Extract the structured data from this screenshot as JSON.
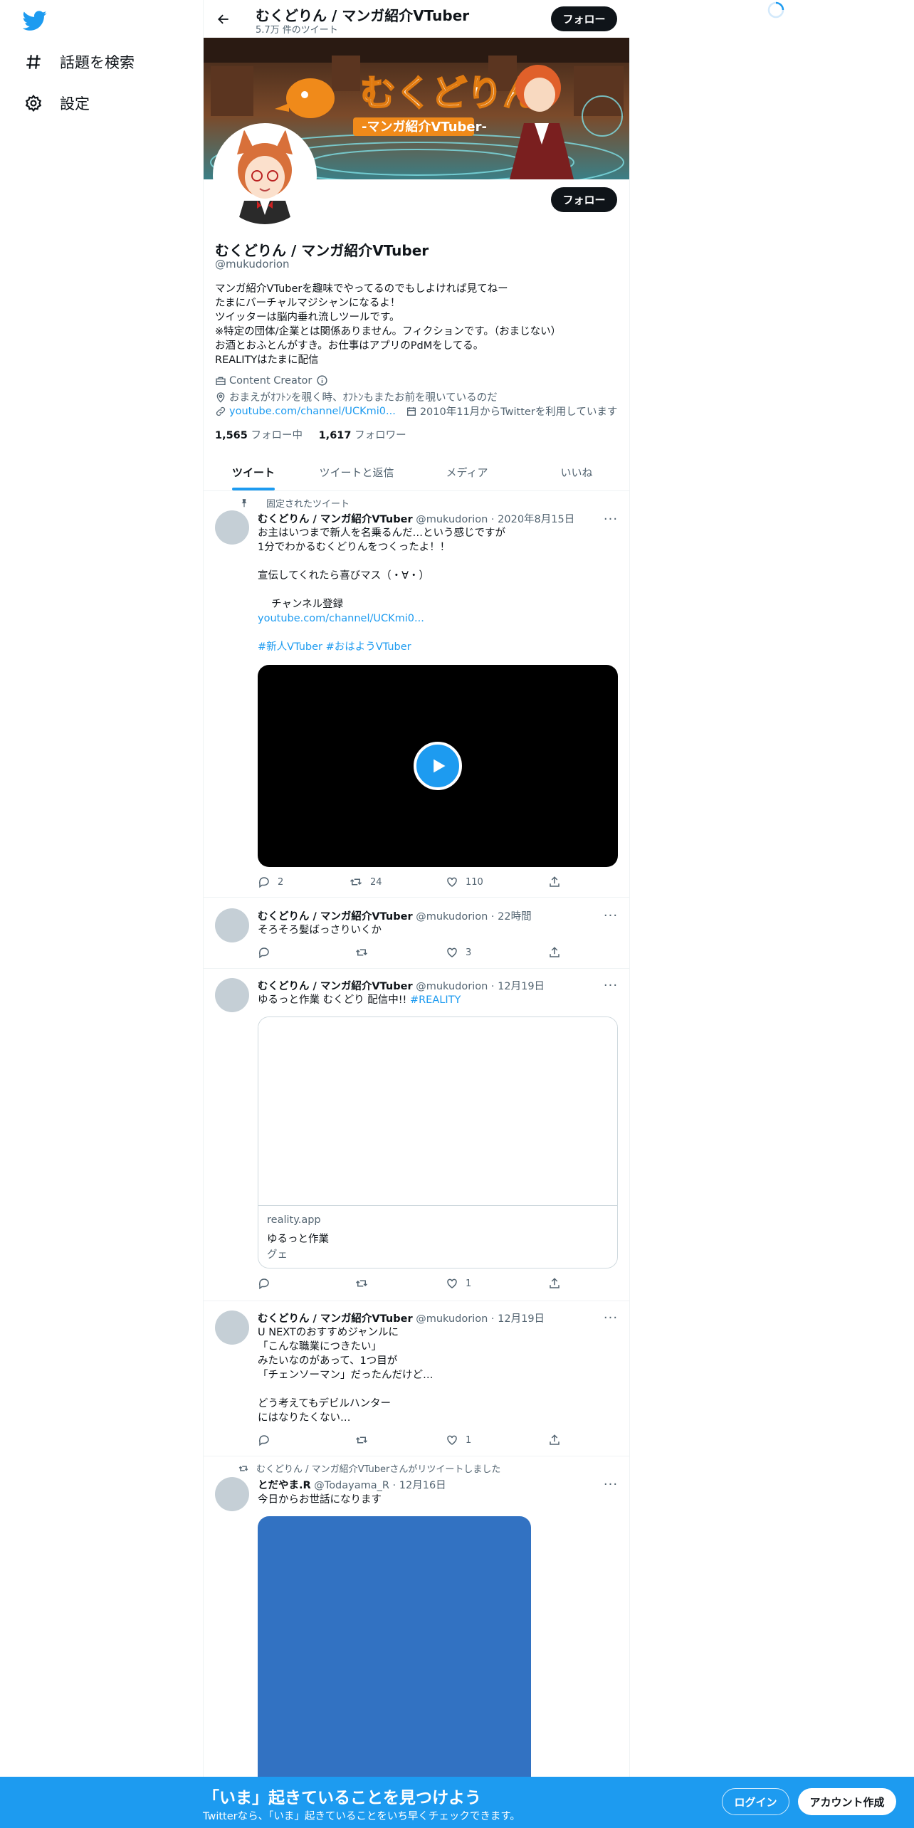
{
  "nav": {
    "explore": "話題を検索",
    "settings": "設定"
  },
  "header": {
    "name": "むくどりん / マンガ紹介VTuber",
    "tweet_count": "5.7万 件のツイート",
    "follow": "フォロー"
  },
  "banner": {
    "title": "むくどりん",
    "subtitle": "-マンガ紹介VTuber-"
  },
  "profile": {
    "name": "むくどりん / マンガ紹介VTuber",
    "handle": "@mukudorion",
    "follow": "フォロー",
    "bio": "マンガ紹介VTuberを趣味でやってるのでもしよければ見てねー\nたまにバーチャルマジシャンになるよ！\nツイッターは脳内垂れ流しツールです。\n※特定の団体/企業とは関係ありません。フィクションです。（おまじない）\nお酒とおふとんがすき。お仕事はアプリのPdMをしてる。\nREALITYはたまに配信",
    "category": "Content Creator",
    "location": "おまえがｵﾌﾄﾝを覗く時、ｵﾌﾄﾝもまたお前を覗いているのだ",
    "url": "youtube.com/channel/UCKmi0...",
    "joined": "2010年11月からTwitterを利用しています",
    "following_count": "1,565",
    "following_label": "フォロー中",
    "followers_count": "1,617",
    "followers_label": "フォロワー"
  },
  "tabs": [
    "ツイート",
    "ツイートと返信",
    "メディア",
    "いいね"
  ],
  "tweets": [
    {
      "context": "固定されたツイート",
      "name": "むくどりん / マンガ紹介VTuber",
      "handle": "@mukudorion",
      "time": "2020年8月15日",
      "text": "お主はいつまで新人を名乗るんだ…という感じですが\n1分でわかるむくどりんをつくったよ！！\n\n宣伝してくれたら喜びマス（・∀・）\n\n　 チャンネル登録",
      "link": "youtube.com/channel/UCKmi0...",
      "hashtags": "#新人VTuber #おはようVTuber",
      "replies": "2",
      "retweets": "24",
      "likes": "110"
    },
    {
      "name": "むくどりん / マンガ紹介VTuber",
      "handle": "@mukudorion",
      "time": "22時間",
      "text": "そろそろ髪ばっさりいくか",
      "replies": "",
      "retweets": "",
      "likes": "3"
    },
    {
      "name": "むくどりん / マンガ紹介VTuber",
      "handle": "@mukudorion",
      "time": "12月19日",
      "text": "ゆるっと作業 むくどり 配信中!! ",
      "hashtag": "#REALITY",
      "card_domain": "reality.app",
      "card_title": "ゆるっと作業",
      "card_desc": "グェ",
      "replies": "",
      "retweets": "",
      "likes": "1"
    },
    {
      "name": "むくどりん / マンガ紹介VTuber",
      "handle": "@mukudorion",
      "time": "12月19日",
      "text": "U NEXTのおすすめジャンルに\n「こんな職業につきたい」\nみたいなのがあって、1つ目が\n「チェンソーマン」だったんだけど…\n\nどう考えてもデビルハンター\nにはなりたくない…",
      "replies": "",
      "retweets": "",
      "likes": "1"
    },
    {
      "context": "むくどりん / マンガ紹介VTuberさんがリツイートしました",
      "name": "とだやま.R",
      "handle": "@Todayama_R",
      "time": "12月16日",
      "text": "今日からお世話になります"
    }
  ],
  "bottom_bar": {
    "title": "「いま」起きていることを見つけよう",
    "subtitle": "Twitterなら、「いま」起きていることをいち早くチェックできます。",
    "login": "ログイン",
    "signup": "アカウント作成"
  },
  "colors": {
    "accent": "#1d9bf0",
    "text": "#0f1419",
    "muted": "#536471",
    "video_play": "#1d9bf0",
    "retweet_image": "#3272c2"
  }
}
